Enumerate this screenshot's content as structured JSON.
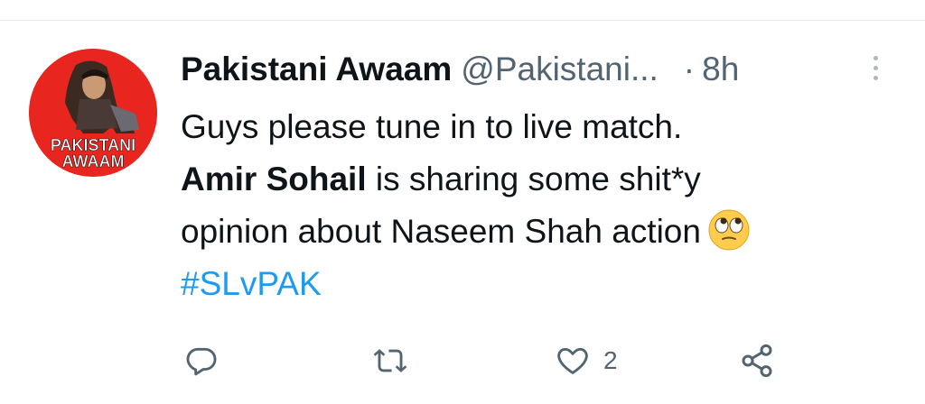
{
  "tweet": {
    "author_name": "Pakistani Awaam",
    "author_handle": "@Pakistani...",
    "separator": "·",
    "timestamp": "8h",
    "avatar_text_top": "PAKISTANI",
    "avatar_text_bottom": "AWAAM",
    "text_line1": "Guys please tune in to live match.",
    "text_bold": "Amir Sohail",
    "text_line2_rest": " is sharing some shit*y",
    "text_line3": "opinion about Naseem Shah action",
    "hashtag": "#SLvPAK",
    "emoji": "face-with-rolling-eyes"
  },
  "actions": {
    "reply_count": "",
    "retweet_count": "",
    "like_count": "2",
    "share_count": ""
  },
  "colors": {
    "avatar_bg": "#e8251f",
    "link": "#1d9bf0",
    "secondary_text": "#536471",
    "icon": "#536471"
  }
}
